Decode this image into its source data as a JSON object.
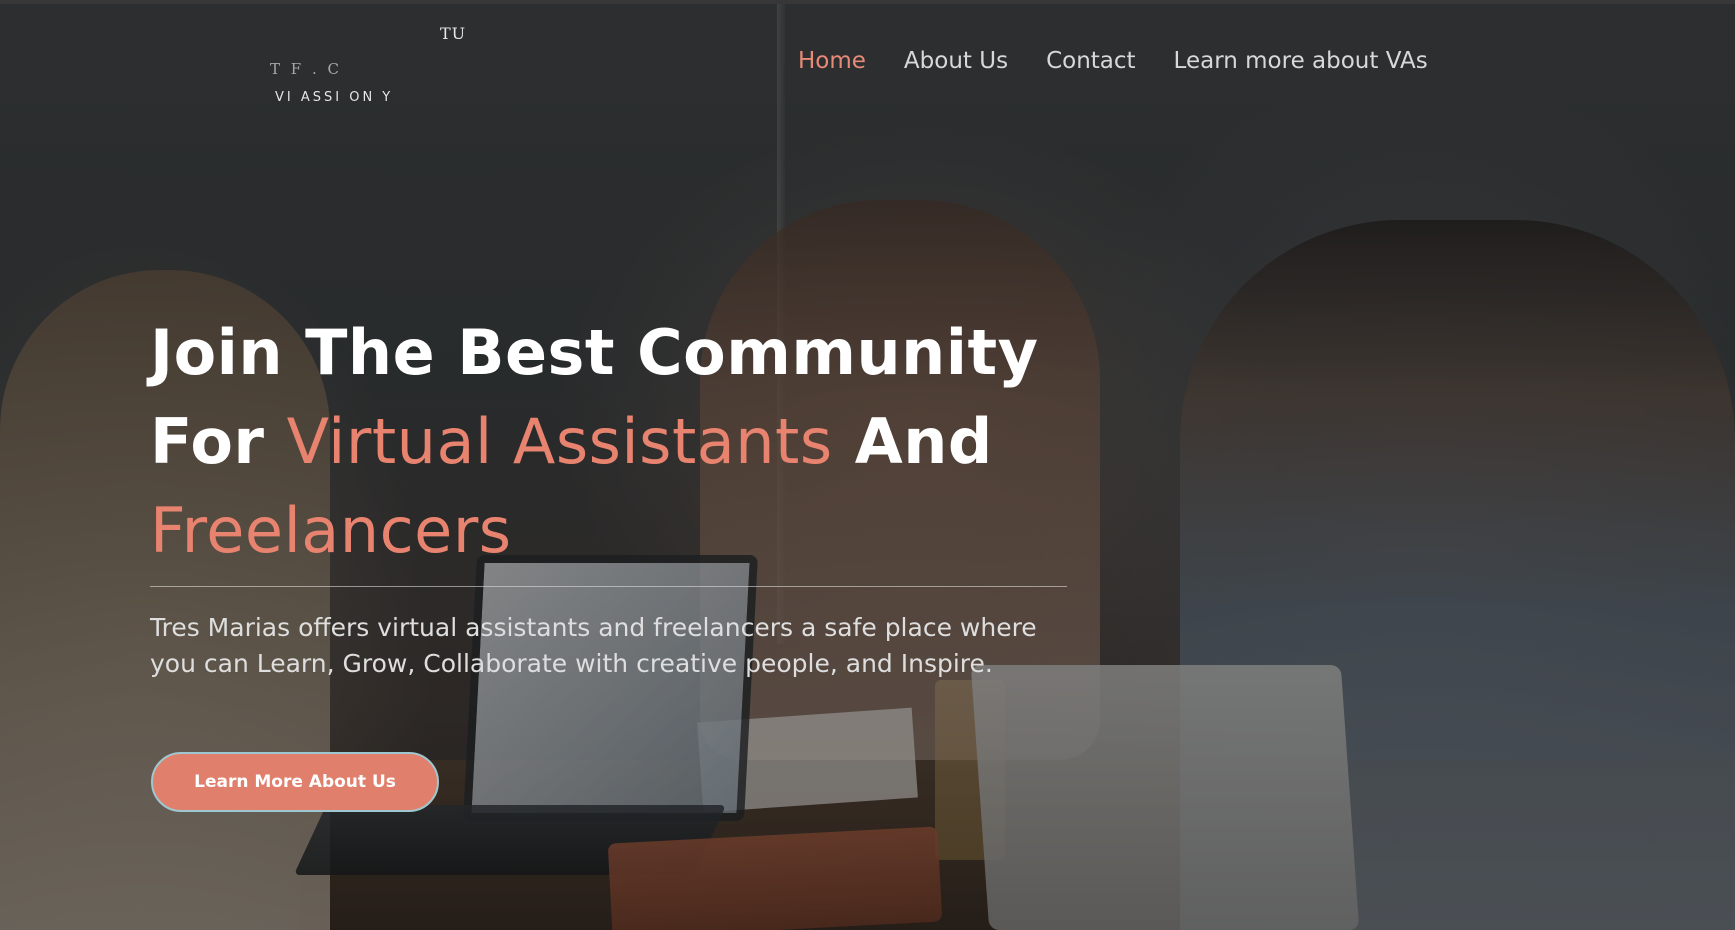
{
  "logo": {
    "mark": "TU",
    "title": "T F . C",
    "subtitle": "VI ASSI ON Y"
  },
  "nav": {
    "items": [
      {
        "label": "Home",
        "active": true
      },
      {
        "label": "About Us",
        "active": false
      },
      {
        "label": "Contact",
        "active": false
      },
      {
        "label": "Learn more about VAs",
        "active": false
      }
    ]
  },
  "hero": {
    "headline_part1": "Join The Best Community For ",
    "headline_accent1": "Virtual Assistants",
    "headline_part2": " And ",
    "headline_accent2": "Freelancers",
    "description": "Tres Marias offers virtual assistants and freelancers a safe place where you can Learn, Grow, Collaborate with creative people, and Inspire.",
    "cta_label": "Learn More About Us"
  },
  "colors": {
    "accent": "#e8836f",
    "button": "#e0806c",
    "button_border": "#9fc7cf",
    "text": "#ffffff"
  }
}
